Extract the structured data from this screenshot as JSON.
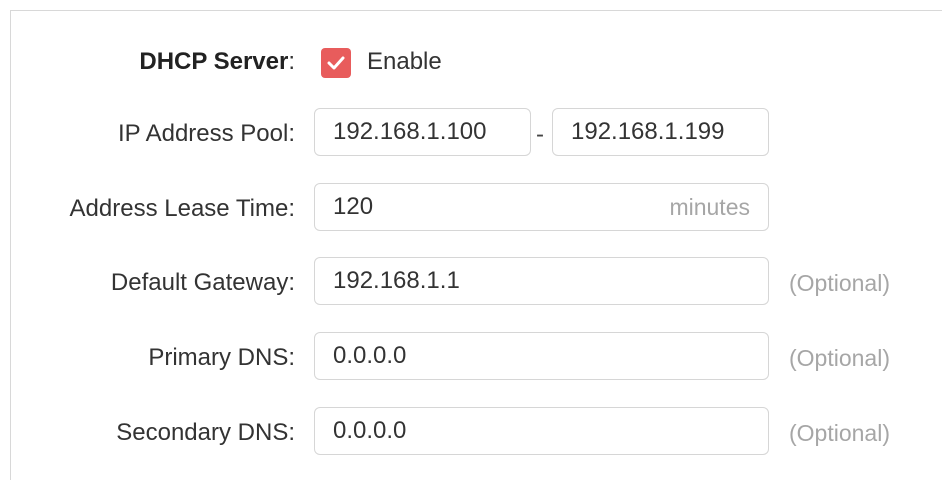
{
  "dhcp": {
    "server_label": "DHCP Server",
    "server_colon": ":",
    "enable_label": "Enable",
    "enabled": true,
    "accent_color": "#e85c5c"
  },
  "ip_pool": {
    "label": "IP Address Pool:",
    "start": "192.168.1.100",
    "separator": "-",
    "end": "192.168.1.199"
  },
  "lease": {
    "label": "Address Lease Time:",
    "value": "120",
    "unit": "minutes"
  },
  "gateway": {
    "label": "Default Gateway:",
    "value": "192.168.1.1",
    "hint": "(Optional)"
  },
  "primary_dns": {
    "label": "Primary DNS:",
    "value": "0.0.0.0",
    "hint": "(Optional)"
  },
  "secondary_dns": {
    "label": "Secondary DNS:",
    "value": "0.0.0.0",
    "hint": "(Optional)"
  }
}
